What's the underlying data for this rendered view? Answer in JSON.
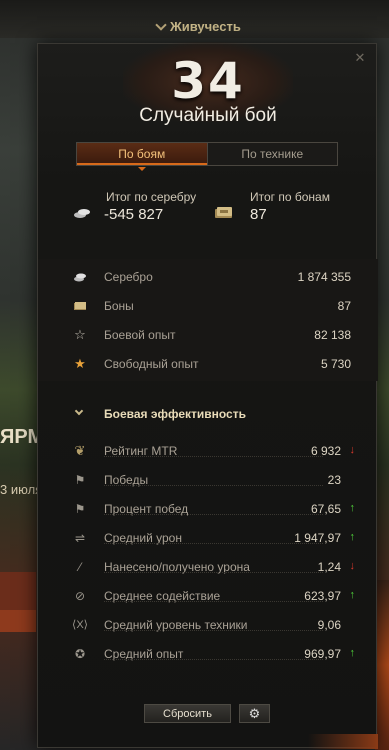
{
  "background": {
    "topbar_title": "Живучесть",
    "left_text": "ЯРМ",
    "left_date": "3 июля"
  },
  "panel": {
    "count": "34",
    "title": "Случайный бой",
    "tabs": [
      {
        "label": "По боям",
        "active": true
      },
      {
        "label": "По технике",
        "active": false
      }
    ],
    "totals": {
      "silver": {
        "label": "Итог по серебру",
        "value": "-545 827",
        "icon": "silver-coins-icon"
      },
      "bonds": {
        "label": "Итог по бонам",
        "value": "87",
        "icon": "bonds-icon"
      }
    },
    "resources": [
      {
        "label": "Серебро",
        "value": "1 874 355",
        "icon": "silver-icon"
      },
      {
        "label": "Боны",
        "value": "87",
        "icon": "bonds-icon"
      },
      {
        "label": "Боевой опыт",
        "value": "82 138",
        "icon": "star-outline-icon"
      },
      {
        "label": "Свободный опыт",
        "value": "5 730",
        "icon": "star-filled-icon"
      }
    ],
    "section_title": "Боевая эффективность",
    "efficiency": [
      {
        "label": "Рейтинг MTR",
        "value": "6 932",
        "trend": "down",
        "icon": "laurel-icon"
      },
      {
        "label": "Победы",
        "value": "23",
        "trend": "",
        "icon": "flag-icon"
      },
      {
        "label": "Процент побед",
        "value": "67,65",
        "trend": "up",
        "icon": "flag-icon"
      },
      {
        "label": "Средний урон",
        "value": "1 947,97",
        "trend": "up",
        "icon": "shell-icon"
      },
      {
        "label": "Нанесено/получено урона",
        "value": "1,24",
        "trend": "down",
        "icon": "damage-ratio-icon"
      },
      {
        "label": "Среднее содействие",
        "value": "623,97",
        "trend": "up",
        "icon": "assist-icon"
      },
      {
        "label": "Средний уровень техники",
        "value": "9,06",
        "trend": "",
        "icon": "tank-tier-icon"
      },
      {
        "label": "Средний опыт",
        "value": "969,97",
        "trend": "up",
        "icon": "star-wing-icon"
      }
    ],
    "reset_label": "Сбросить",
    "colors": {
      "up": "#4fcf3a",
      "down": "#d8382c",
      "accent": "#d86a1a"
    }
  }
}
